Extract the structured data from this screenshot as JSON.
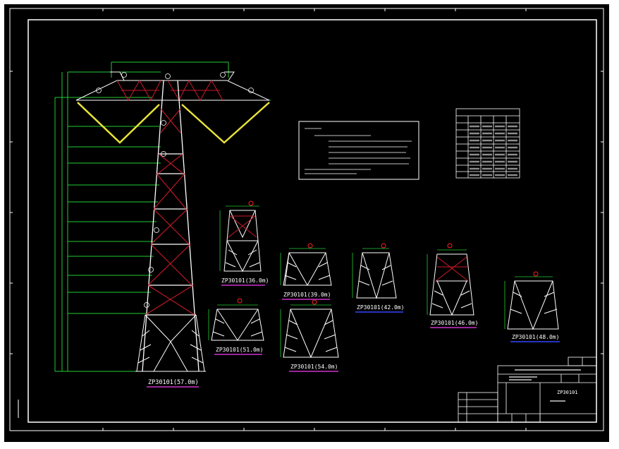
{
  "colors": {
    "background": "#000000",
    "frame": "#ffffff",
    "tower_member": "#ffffff",
    "bracing": "#cc1a2a",
    "dimension": "#22cc33",
    "insulator": "#e8e33a",
    "caption_underline": "#cc33cc",
    "caption_underline_alt": "#3344ff",
    "marker": "#ff2020"
  },
  "icons": {
    "callout": "circled-number-icon",
    "frame_ticks": "border-tick-icon"
  },
  "tower_captions": {
    "main": "ZP30101(57.0m)",
    "h36": "ZP30101(36.0m)",
    "h39": "ZP30101(39.0m)",
    "h42": "ZP30101(42.0m)",
    "h46": "ZP30101(46.0m)",
    "h48": "ZP30101(48.0m)",
    "h51": "ZP30101(51.0m)",
    "h54": "ZP30101(54.0m)"
  },
  "title_block": {
    "drawing_code": "ZP30101"
  }
}
